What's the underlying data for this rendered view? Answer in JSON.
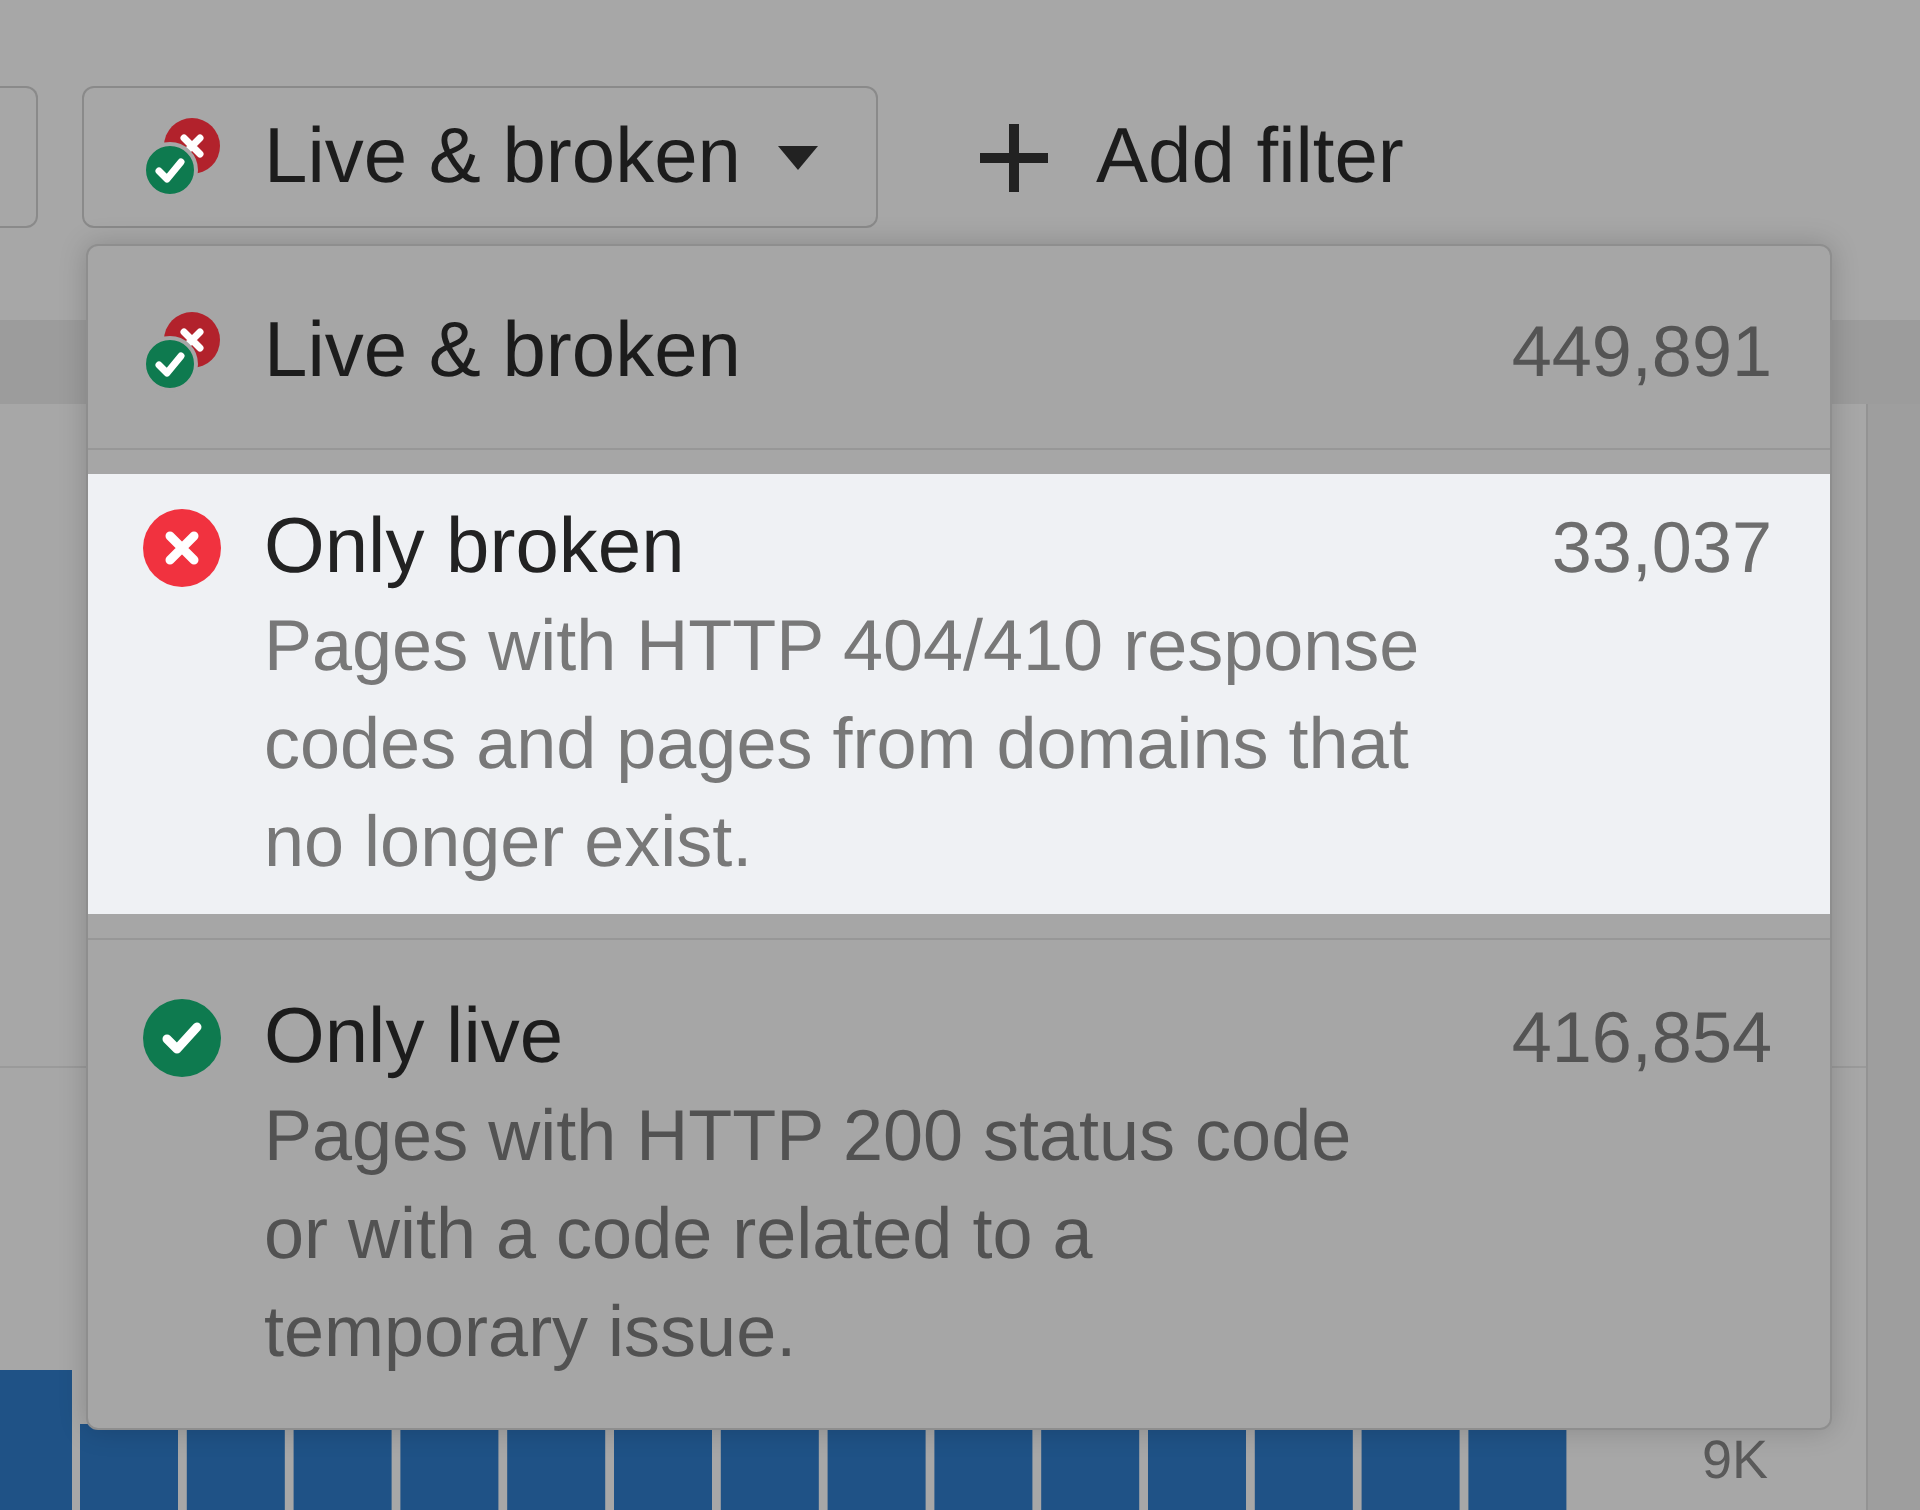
{
  "toolbar": {
    "status_filter": {
      "label": "Live & broken",
      "kind": "mixed"
    },
    "add_filter": {
      "label": "Add filter"
    }
  },
  "menu": {
    "items": [
      {
        "label": "Live & broken",
        "count": "449,891",
        "kind": "mixed",
        "selected": false
      },
      {
        "label": "Only broken",
        "count": "33,037",
        "description": "Pages with HTTP 404/410 response codes and pages from domains that no longer exist.",
        "kind": "broken",
        "selected": true
      },
      {
        "label": "Only live",
        "count": "416,854",
        "description": "Pages with HTTP 200 status code or with a code related to a temporary issue.",
        "kind": "live",
        "selected": false
      }
    ]
  },
  "chart": {
    "axis_label": "9K"
  }
}
